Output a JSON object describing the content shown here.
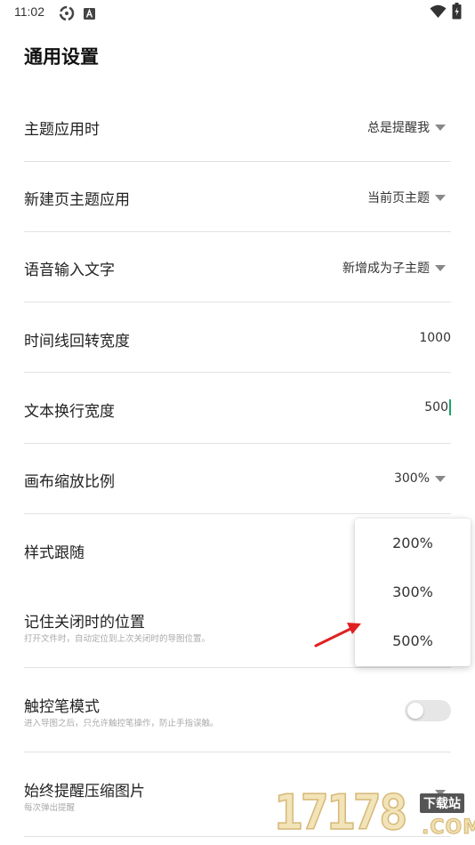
{
  "status_bar": {
    "time": "11:02",
    "icons": [
      "sync-icon",
      "a-badge-icon",
      "wifi-icon",
      "battery-icon"
    ]
  },
  "page_title": "通用设置",
  "settings": [
    {
      "label": "主题应用时",
      "value": "总是提醒我",
      "type": "dropdown"
    },
    {
      "label": "新建页主题应用",
      "value": "当前页主题",
      "type": "dropdown"
    },
    {
      "label": "语音输入文字",
      "value": "新增成为子主题",
      "type": "dropdown"
    },
    {
      "label": "时间线回转宽度",
      "value": "1000",
      "type": "number"
    },
    {
      "label": "文本换行宽度",
      "value": "500",
      "type": "number-editing"
    },
    {
      "label": "画布缩放比例",
      "value": "300%",
      "type": "dropdown"
    },
    {
      "label": "样式跟随",
      "type": "dropdown"
    },
    {
      "label": "记住关闭时的位置",
      "description": "打开文件时，自动定位到上次关闭时的导图位置。",
      "type": "toggle"
    },
    {
      "label": "触控笔模式",
      "description": "进入导图之后，只允许触控笔操作，防止手指误触。",
      "type": "toggle",
      "checked": false
    },
    {
      "label": "始终提醒压缩图片",
      "description": "每次弹出提醒",
      "type": "dropdown"
    }
  ],
  "zoom_dropdown": {
    "options": [
      "200%",
      "300%",
      "500%"
    ]
  },
  "annotation": {
    "arrow_color": "#e02020"
  },
  "watermark": {
    "digits": "17178",
    "badge": "下载站",
    "suffix": ".COM"
  },
  "colors": {
    "accent": "#1aa36b",
    "divider": "#e2e2e2"
  }
}
